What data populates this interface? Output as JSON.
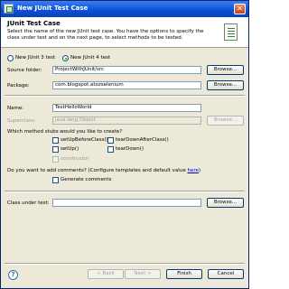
{
  "window": {
    "title": "New JUnit Test Case"
  },
  "banner": {
    "title": "JUnit Test Case",
    "description": "Select the name of the new JUnit test case. You have the options to specify the class under test and on the next page, to select methods to be tested."
  },
  "version": {
    "junit3_label": "New JUnit 3 test",
    "junit4_label": "New JUnit 4 test",
    "selected": "junit4"
  },
  "source_folder": {
    "label": "Source folder:",
    "value": "ProjectWithJUnit/src",
    "browse": "Browse..."
  },
  "package": {
    "label": "Package:",
    "value": "com.blogspot.atozselenium",
    "browse": "Browse..."
  },
  "name": {
    "label": "Name:",
    "value": "TestHelloWorld"
  },
  "superclass": {
    "label": "Superclass:",
    "value": "java.lang.Object",
    "browse": "Browse..."
  },
  "stubs": {
    "question": "Which method stubs would you like to create?",
    "setUpBeforeClass": "setUpBeforeClass()",
    "tearDownAfterClass": "tearDownAfterClass()",
    "setUp": "setUp()",
    "tearDown": "tearDown()",
    "constructor": "constructor"
  },
  "comments": {
    "question_prefix": "Do you want to add comments? (Configure templates and default value ",
    "link": "here",
    "question_suffix": ")",
    "generate": "Generate comments"
  },
  "class_under_test": {
    "label": "Class under test:",
    "value": "",
    "browse": "Browse..."
  },
  "footer": {
    "back": "< Back",
    "next": "Next >",
    "finish": "Finish",
    "cancel": "Cancel"
  },
  "icons": {
    "window": "junit-window-icon",
    "banner": "junit-wizard-icon",
    "help": "help-icon",
    "close": "close-icon"
  }
}
